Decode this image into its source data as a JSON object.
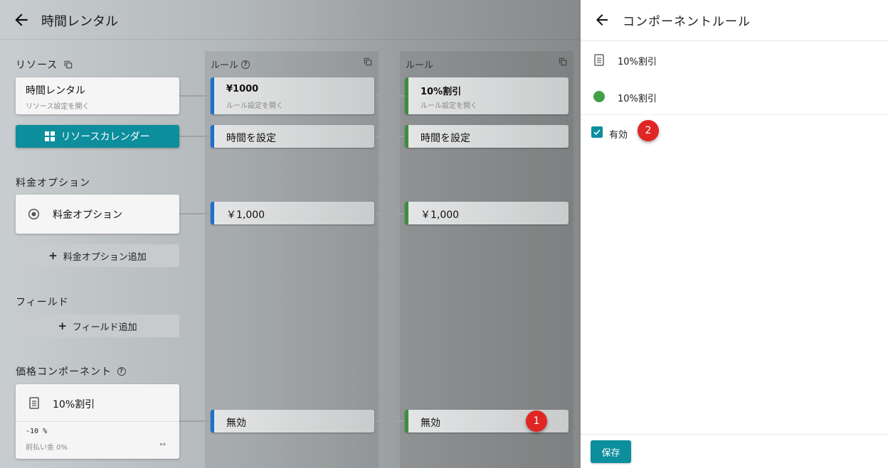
{
  "header": {
    "title": "時間レンタル"
  },
  "columns": [
    {
      "label": "ルール"
    },
    {
      "label": "ルール"
    }
  ],
  "resource": {
    "section_label": "リソース",
    "card_title": "時間レンタル",
    "card_subtitle": "リソース設定を開く",
    "calendar_button": "リソースカレンダー"
  },
  "fee_options": {
    "section_label": "料金オプション",
    "card_title": "料金オプション",
    "add_button": "料金オプション追加"
  },
  "fields": {
    "section_label": "フィールド",
    "add_button": "フィールド追加"
  },
  "price_component": {
    "section_label": "価格コンポーネント",
    "card_title": "10%割引",
    "value": "-10 %",
    "prepay": "前払い金 0%",
    "arrows": "↔"
  },
  "rules_col1": {
    "title": "¥1000",
    "subtitle": "ルール設定を開く",
    "time": "時間を設定",
    "price": "￥1,000",
    "state": "無効",
    "color": "#1e6fd0"
  },
  "rules_col2": {
    "title": "10%割引",
    "subtitle": "ルール設定を開く",
    "time": "時間を設定",
    "price": "￥1,000",
    "state": "無効",
    "color": "#3c8f3c"
  },
  "badges": {
    "one": "1",
    "two": "2"
  },
  "panel": {
    "title": "コンポーネントルール",
    "component_name": "10%割引",
    "rule_name": "10%割引",
    "rule_color": "#43a047",
    "enabled_label": "有効",
    "enabled": true,
    "save_label": "保存"
  },
  "colors": {
    "accent": "#0c8e9d",
    "badge": "#e02525"
  }
}
